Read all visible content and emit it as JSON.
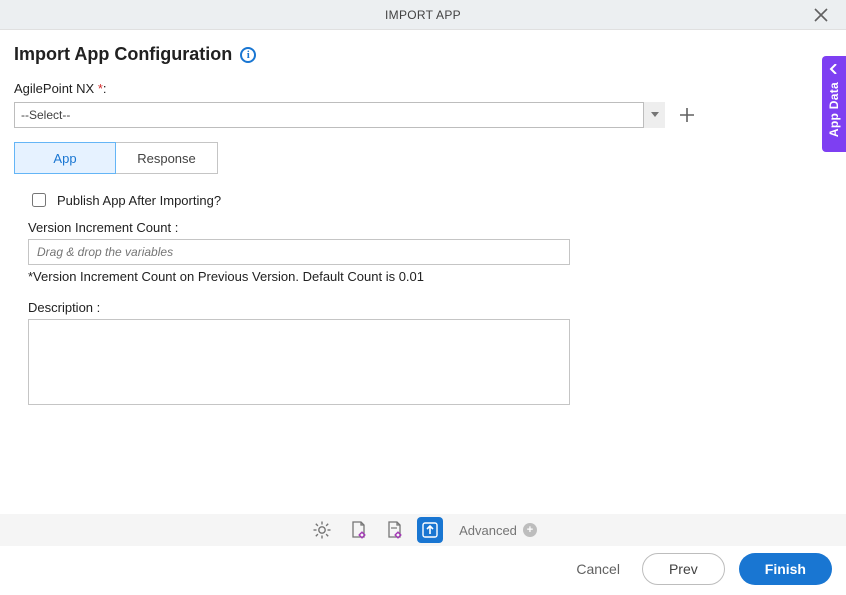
{
  "window": {
    "title": "IMPORT APP"
  },
  "page": {
    "title": "Import App Configuration"
  },
  "fields": {
    "nx_label": "AgilePoint NX",
    "nx_required_marker": "*",
    "nx_colon": ":",
    "nx_select_value": "--Select--",
    "publish_label": "Publish App After Importing?",
    "vic_label": "Version Increment Count :",
    "vic_placeholder": "Drag & drop the variables",
    "vic_help": "*Version Increment Count on Previous Version. Default Count is 0.01",
    "desc_label": "Description :"
  },
  "tabs": {
    "app": "App",
    "response": "Response"
  },
  "rail": {
    "label": "App Data"
  },
  "footer": {
    "advanced": "Advanced"
  },
  "buttons": {
    "cancel": "Cancel",
    "prev": "Prev",
    "finish": "Finish"
  }
}
